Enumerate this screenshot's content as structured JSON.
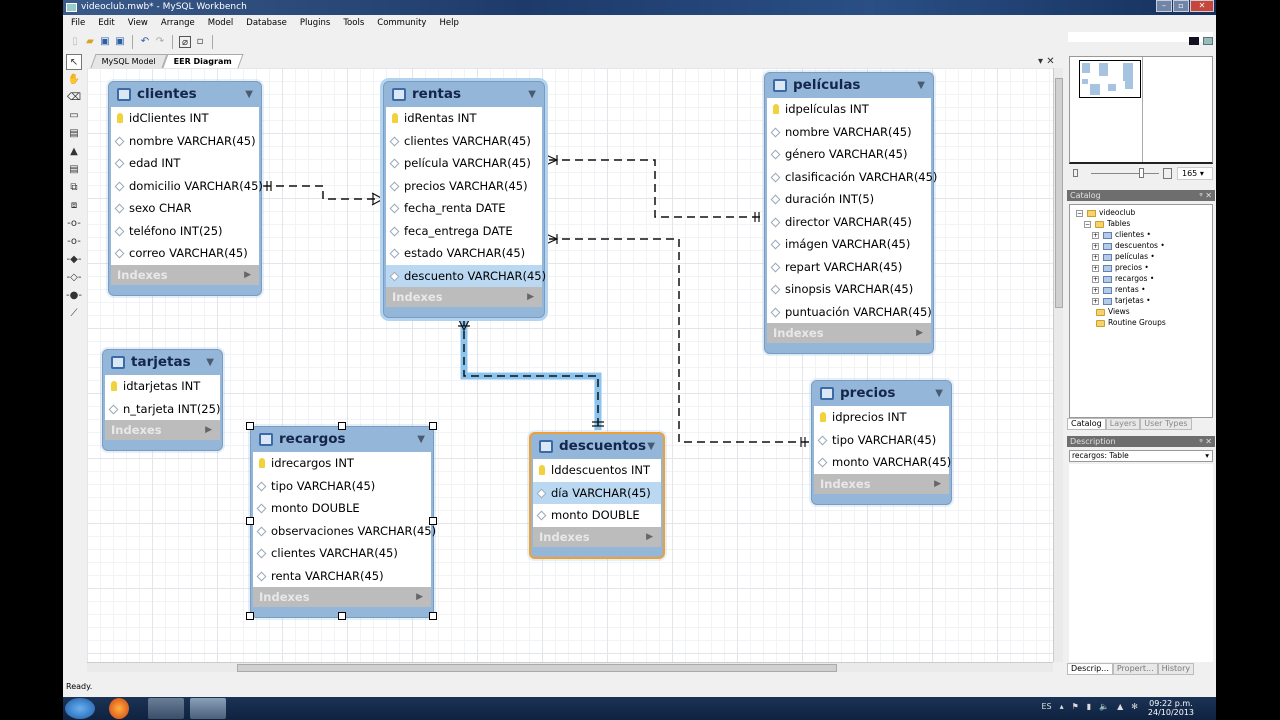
{
  "window": {
    "title": "videoclub.mwb* - MySQL Workbench",
    "controls": [
      "minimize",
      "restore",
      "close"
    ]
  },
  "menu": [
    "File",
    "Edit",
    "View",
    "Arrange",
    "Model",
    "Database",
    "Plugins",
    "Tools",
    "Community",
    "Help"
  ],
  "toolbar": {
    "icons": [
      "new-file-icon",
      "open-icon",
      "save-icon",
      "save-as-icon",
      "undo-icon",
      "redo-icon",
      "toggle-grid-icon",
      "toggle-page-icon"
    ]
  },
  "tabs": [
    {
      "label": "MySQL Model",
      "active": false
    },
    {
      "label": "EER Diagram",
      "active": true
    }
  ],
  "palette": [
    "select-tool-icon",
    "hand-tool-icon",
    "eraser-icon",
    "layer-icon",
    "note-icon",
    "image-icon",
    "table-tool-icon",
    "view-tool-icon",
    "routine-group-icon",
    "relationship-1-1-icon",
    "relationship-1-n-icon",
    "relationship-1-1-identifying-icon",
    "relationship-1-n-identifying-icon",
    "relationship-n-m-icon",
    "relationship-existing-columns-icon"
  ],
  "tables": {
    "clientes": {
      "name": "clientes",
      "columns": [
        {
          "text": "idClientes INT",
          "pk": true
        },
        {
          "text": "nombre VARCHAR(45)"
        },
        {
          "text": "edad INT"
        },
        {
          "text": "domicilio VARCHAR(45)"
        },
        {
          "text": "sexo CHAR"
        },
        {
          "text": "teléfono INT(25)"
        },
        {
          "text": "correo VARCHAR(45)"
        }
      ],
      "indexes": "Indexes"
    },
    "rentas": {
      "name": "rentas",
      "columns": [
        {
          "text": "idRentas INT",
          "pk": true
        },
        {
          "text": "clientes VARCHAR(45)"
        },
        {
          "text": "película VARCHAR(45)"
        },
        {
          "text": "precios VARCHAR(45)"
        },
        {
          "text": "fecha_renta DATE"
        },
        {
          "text": "feca_entrega DATE"
        },
        {
          "text": "estado VARCHAR(45)"
        },
        {
          "text": "descuento VARCHAR(45)",
          "highlighted": true
        }
      ],
      "indexes": "Indexes"
    },
    "peliculas": {
      "name": "películas",
      "columns": [
        {
          "text": "idpelículas INT",
          "pk": true
        },
        {
          "text": "nombre VARCHAR(45)"
        },
        {
          "text": "género VARCHAR(45)"
        },
        {
          "text": "clasificación VARCHAR(45)"
        },
        {
          "text": "duración INT(5)"
        },
        {
          "text": "director VARCHAR(45)"
        },
        {
          "text": "imágen VARCHAR(45)"
        },
        {
          "text": "repart VARCHAR(45)"
        },
        {
          "text": "sinopsis VARCHAR(45)"
        },
        {
          "text": "puntuación VARCHAR(45)"
        }
      ],
      "indexes": "Indexes"
    },
    "tarjetas": {
      "name": "tarjetas",
      "columns": [
        {
          "text": "idtarjetas INT",
          "pk": true
        },
        {
          "text": "n_tarjeta INT(25)"
        }
      ],
      "indexes": "Indexes"
    },
    "recargos": {
      "name": "recargos",
      "columns": [
        {
          "text": "idrecargos INT",
          "pk": true
        },
        {
          "text": "tipo VARCHAR(45)"
        },
        {
          "text": "monto DOUBLE"
        },
        {
          "text": "observaciones VARCHAR(45)"
        },
        {
          "text": "clientes VARCHAR(45)"
        },
        {
          "text": "renta VARCHAR(45)"
        }
      ],
      "indexes": "Indexes"
    },
    "descuentos": {
      "name": "descuentos",
      "columns": [
        {
          "text": "lddescuentos INT",
          "pk": true
        },
        {
          "text": "día VARCHAR(45)",
          "highlighted": true
        },
        {
          "text": "monto DOUBLE"
        }
      ],
      "indexes": "Indexes"
    },
    "precios": {
      "name": "precios",
      "columns": [
        {
          "text": "idprecios INT",
          "pk": true
        },
        {
          "text": "tipo VARCHAR(45)"
        },
        {
          "text": "monto VARCHAR(45)"
        }
      ],
      "indexes": "Indexes"
    }
  },
  "relationships": [
    {
      "from": "clientes",
      "to": "rentas",
      "style": "dashed"
    },
    {
      "from": "rentas",
      "to": "películas",
      "style": "dashed"
    },
    {
      "from": "rentas",
      "to": "precios",
      "style": "dashed"
    },
    {
      "from": "rentas",
      "to": "descuentos",
      "style": "dashed",
      "selected": true
    }
  ],
  "navigator": {
    "zoom": "165"
  },
  "catalog": {
    "title": "Catalog",
    "schema": "videoclub",
    "tables_folder": "Tables",
    "tables": [
      "clientes",
      "descuentos",
      "películas",
      "precios",
      "recargos",
      "rentas",
      "tarjetas"
    ],
    "other_folders": [
      "Views",
      "Routine Groups"
    ],
    "tabs": [
      {
        "label": "Catalog",
        "active": true
      },
      {
        "label": "Layers"
      },
      {
        "label": "User Types"
      }
    ]
  },
  "description": {
    "title": "Description",
    "selected": "recargos: Table",
    "tabs": [
      {
        "label": "Descrip...",
        "active": true
      },
      {
        "label": "Propert..."
      },
      {
        "label": "History"
      }
    ]
  },
  "status": "Ready.",
  "taskbar": {
    "language": "ES",
    "time": "09:22 p.m.",
    "date": "24/10/2013",
    "apps": [
      "start-button",
      "firefox-icon",
      "explorer-icon",
      "workbench-icon"
    ]
  }
}
